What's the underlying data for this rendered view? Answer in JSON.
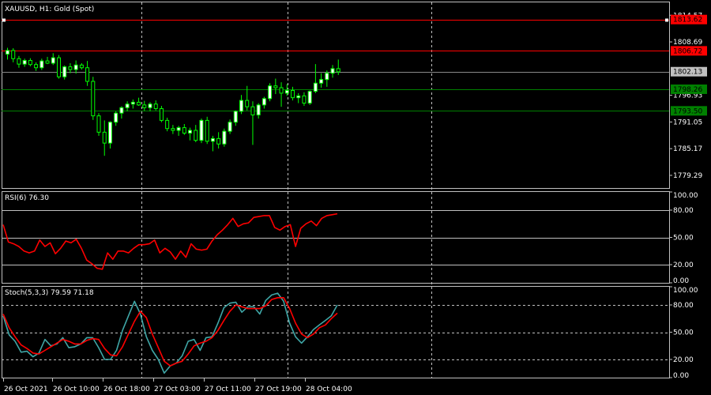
{
  "chart_data": [
    {
      "type": "candlestick",
      "title": "XAUUSD, H1:  Gold (Spot)",
      "ylim": [
        1776.5,
        1817.4
      ],
      "yticks": [
        "1814.57",
        "1808.69",
        "1796.93",
        "1791.05",
        "1785.17",
        "1779.29"
      ],
      "price_labels": [
        {
          "text": "1813.62",
          "value": 1813.62,
          "bg": "#ff0000"
        },
        {
          "text": "1806.72",
          "value": 1806.72,
          "bg": "#ff0000"
        },
        {
          "text": "1802.13",
          "value": 1802.13,
          "bg": "#c0c0c0"
        },
        {
          "text": "1798.26",
          "value": 1798.26,
          "bg": "#008000"
        },
        {
          "text": "1793.50",
          "value": 1793.5,
          "bg": "#008000"
        }
      ],
      "levels": [
        {
          "value": 1813.62,
          "color": "#ff0000"
        },
        {
          "value": 1806.72,
          "color": "#ff0000"
        },
        {
          "value": 1802.13,
          "color": "#888888"
        },
        {
          "value": 1798.26,
          "color": "#008000"
        },
        {
          "value": 1793.5,
          "color": "#008000"
        }
      ],
      "up_color": "#ffffff",
      "down_color": "#000000",
      "wick_color": "#00ff00",
      "candles": [
        [
          1806.0,
          1807.4,
          1804.8,
          1806.8
        ],
        [
          1806.8,
          1807.3,
          1804.2,
          1805.0
        ],
        [
          1805.0,
          1805.6,
          1803.0,
          1803.8
        ],
        [
          1803.8,
          1805.0,
          1803.2,
          1804.6
        ],
        [
          1804.6,
          1805.1,
          1803.3,
          1803.7
        ],
        [
          1803.7,
          1804.2,
          1802.3,
          1803.0
        ],
        [
          1803.0,
          1805.0,
          1802.5,
          1804.5
        ],
        [
          1804.5,
          1805.4,
          1803.8,
          1804.0
        ],
        [
          1804.0,
          1806.2,
          1803.6,
          1805.2
        ],
        [
          1805.2,
          1805.8,
          1800.6,
          1801.0
        ],
        [
          1801.0,
          1803.5,
          1800.4,
          1803.2
        ],
        [
          1803.2,
          1804.0,
          1801.8,
          1802.6
        ],
        [
          1802.6,
          1804.6,
          1801.7,
          1803.6
        ],
        [
          1803.6,
          1804.0,
          1802.6,
          1803.0
        ],
        [
          1803.0,
          1804.5,
          1799.0,
          1800.0
        ],
        [
          1800.0,
          1801.0,
          1791.5,
          1792.4
        ],
        [
          1792.4,
          1793.0,
          1788.0,
          1788.8
        ],
        [
          1788.8,
          1791.4,
          1783.6,
          1786.4
        ],
        [
          1786.4,
          1791.2,
          1785.2,
          1791.0
        ],
        [
          1791.0,
          1793.4,
          1790.2,
          1793.0
        ],
        [
          1793.0,
          1794.5,
          1791.8,
          1794.2
        ],
        [
          1794.2,
          1795.6,
          1793.4,
          1795.0
        ],
        [
          1795.0,
          1796.0,
          1794.0,
          1795.4
        ],
        [
          1795.4,
          1796.4,
          1794.6,
          1794.8
        ],
        [
          1794.8,
          1795.7,
          1793.5,
          1794.2
        ],
        [
          1794.2,
          1795.4,
          1793.4,
          1795.0
        ],
        [
          1795.0,
          1795.8,
          1793.6,
          1794.0
        ],
        [
          1794.0,
          1794.6,
          1791.0,
          1791.4
        ],
        [
          1791.4,
          1792.0,
          1789.0,
          1789.6
        ],
        [
          1789.6,
          1790.4,
          1788.4,
          1789.2
        ],
        [
          1789.2,
          1790.2,
          1788.0,
          1789.8
        ],
        [
          1789.8,
          1790.6,
          1788.2,
          1788.6
        ],
        [
          1788.6,
          1789.8,
          1787.0,
          1789.2
        ],
        [
          1789.2,
          1790.4,
          1786.6,
          1787.0
        ],
        [
          1787.0,
          1791.8,
          1786.4,
          1791.4
        ],
        [
          1791.4,
          1792.2,
          1786.2,
          1786.8
        ],
        [
          1786.8,
          1788.0,
          1784.6,
          1787.4
        ],
        [
          1787.4,
          1788.8,
          1785.2,
          1786.2
        ],
        [
          1786.2,
          1789.6,
          1785.6,
          1789.0
        ],
        [
          1789.0,
          1791.6,
          1788.4,
          1791.0
        ],
        [
          1791.0,
          1793.6,
          1790.2,
          1793.4
        ],
        [
          1793.4,
          1797.0,
          1792.8,
          1795.8
        ],
        [
          1795.8,
          1799.0,
          1793.6,
          1794.4
        ],
        [
          1794.4,
          1795.6,
          1786.0,
          1792.6
        ],
        [
          1792.6,
          1795.2,
          1791.8,
          1794.8
        ],
        [
          1794.8,
          1796.6,
          1794.0,
          1796.2
        ],
        [
          1796.2,
          1799.6,
          1795.6,
          1799.0
        ],
        [
          1799.0,
          1800.6,
          1797.2,
          1798.6
        ],
        [
          1798.6,
          1799.8,
          1794.4,
          1797.4
        ],
        [
          1797.4,
          1799.4,
          1796.8,
          1798.0
        ],
        [
          1798.0,
          1798.8,
          1795.8,
          1796.4
        ],
        [
          1796.4,
          1797.4,
          1795.2,
          1796.8
        ],
        [
          1796.8,
          1797.6,
          1794.6,
          1795.2
        ],
        [
          1795.2,
          1798.0,
          1794.8,
          1797.8
        ],
        [
          1797.8,
          1803.8,
          1797.4,
          1799.6
        ],
        [
          1799.6,
          1801.8,
          1798.6,
          1800.4
        ],
        [
          1800.4,
          1802.4,
          1798.8,
          1801.8
        ],
        [
          1801.8,
          1803.6,
          1800.8,
          1802.8
        ],
        [
          1802.8,
          1804.8,
          1801.4,
          1802.1
        ]
      ]
    },
    {
      "type": "line",
      "title": "RSI(6) 76.30",
      "ylim": [
        0,
        100
      ],
      "yticks": [
        "100.00",
        "80.00",
        "50.00",
        "20.00",
        "0.00"
      ],
      "levels": [
        80,
        50,
        20
      ],
      "series": [
        {
          "color": "#ff0000",
          "values": [
            64,
            45,
            43,
            40,
            35,
            33,
            35,
            47,
            40,
            44,
            32,
            38,
            46,
            44,
            48,
            38,
            25,
            21,
            16,
            15,
            33,
            26,
            35,
            35,
            33,
            38,
            42,
            42,
            43,
            47,
            33,
            38,
            34,
            26,
            35,
            28,
            43,
            37,
            36,
            37,
            46,
            53,
            58,
            64,
            71,
            62,
            65,
            66,
            72,
            73,
            74,
            74,
            61,
            58,
            62,
            64,
            40,
            60,
            65,
            68,
            63,
            71,
            74,
            75,
            76
          ]
        }
      ]
    },
    {
      "type": "line",
      "title": "Stoch(5,3,3) 79.59 71.18",
      "ylim": [
        0,
        100
      ],
      "yticks": [
        "100.00",
        "80.00",
        "50.00",
        "20.00",
        "0.00"
      ],
      "levels": [
        80,
        50,
        20
      ],
      "series": [
        {
          "color": "#3fa6a6",
          "values": [
            68,
            47,
            40,
            28,
            29,
            23,
            27,
            42,
            35,
            37,
            44,
            33,
            34,
            37,
            44,
            44,
            33,
            20,
            20,
            30,
            52,
            68,
            84,
            70,
            45,
            30,
            20,
            5,
            13,
            16,
            24,
            40,
            42,
            30,
            44,
            45,
            60,
            77,
            82,
            83,
            72,
            78,
            78,
            70,
            85,
            91,
            93,
            84,
            60,
            45,
            38,
            45,
            53,
            58,
            63,
            68,
            80
          ]
        },
        {
          "color": "#ff0000",
          "values": [
            70,
            55,
            45,
            36,
            32,
            27,
            26,
            30,
            34,
            38,
            42,
            40,
            37,
            37,
            41,
            43,
            42,
            32,
            25,
            24,
            34,
            48,
            62,
            73,
            66,
            48,
            33,
            18,
            13,
            16,
            18,
            26,
            35,
            38,
            40,
            44,
            52,
            63,
            73,
            80,
            78,
            76,
            76,
            76,
            79,
            86,
            88,
            88,
            76,
            60,
            48,
            44,
            48,
            55,
            58,
            65,
            71
          ]
        }
      ]
    }
  ],
  "time_axis": [
    "26 Oct 2021",
    "26 Oct 10:00",
    "26 Oct 18:00",
    "27 Oct 03:00",
    "27 Oct 11:00",
    "27 Oct 19:00",
    "28 Oct 04:00"
  ]
}
